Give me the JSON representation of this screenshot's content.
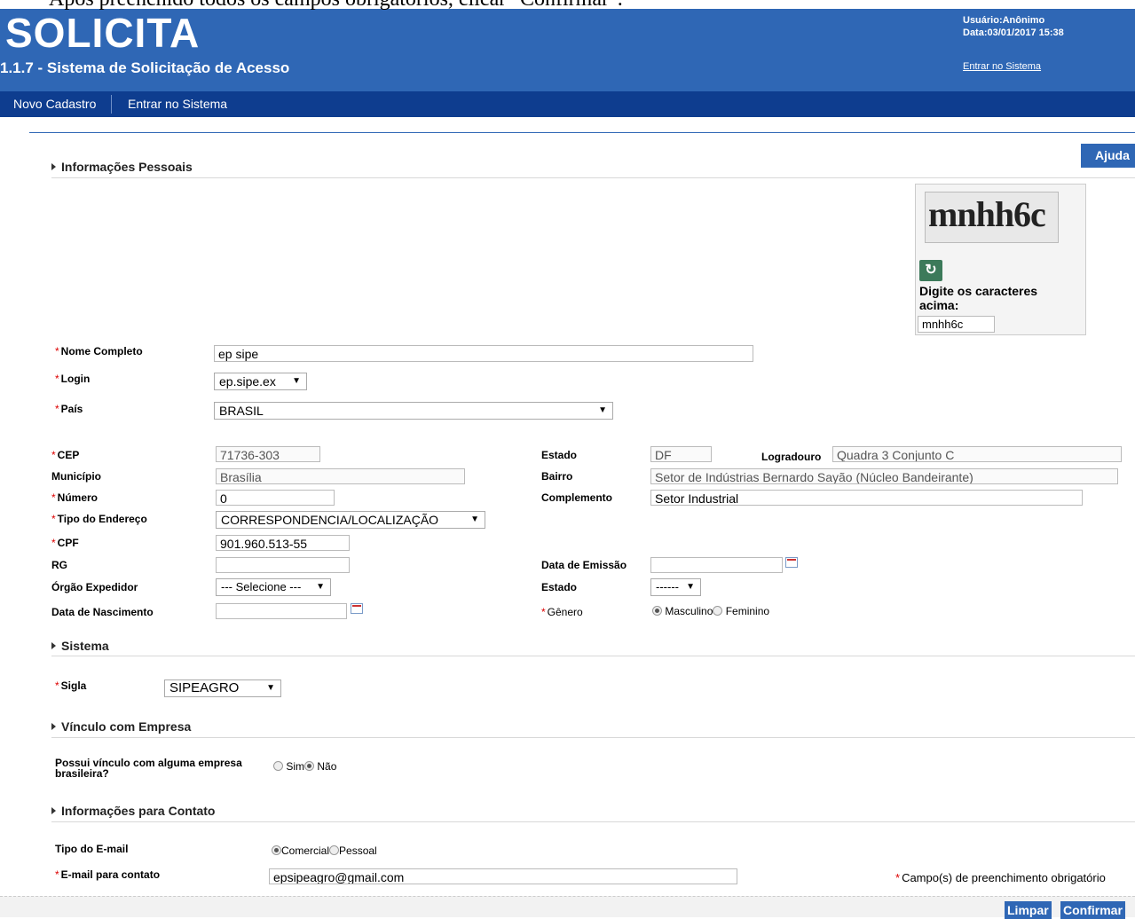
{
  "caption": "Após preenchido todos os campos obrigatórios, clicar \"Confirmar\".",
  "header": {
    "logo": "SOLICITA",
    "system_title": "1.1.7 - Sistema de Solicitação de Acesso",
    "user": "Usuário:Anônimo",
    "date": "Data:03/01/2017 15:38",
    "enter_link": "Entrar no Sistema"
  },
  "menu": {
    "items": [
      "Novo Cadastro",
      "Entrar no Sistema"
    ]
  },
  "help_button": "Ajuda",
  "captcha": {
    "image_text": "mnhh6c",
    "prompt": "Digite os caracteres acima:",
    "value": "mnhh6c"
  },
  "sections": {
    "personal": "Informações Pessoais",
    "system": "Sistema",
    "company": "Vínculo com Empresa",
    "contact": "Informações para Contato"
  },
  "personal": {
    "nome_label": "Nome Completo",
    "nome_value": "ep sipe",
    "login_label": "Login",
    "login_value": "ep.sipe.ex",
    "pais_label": "País",
    "pais_value": "BRASIL",
    "cep_label": "CEP",
    "cep_value": "71736-303",
    "estado_label": "Estado",
    "estado_value": "DF",
    "logradouro_label": "Logradouro",
    "logradouro_value": "Quadra 3 Conjunto C",
    "municipio_label": "Município",
    "municipio_value": "Brasília",
    "bairro_label": "Bairro",
    "bairro_value": "Setor de Indústrias Bernardo Sayão (Núcleo Bandeirante)",
    "numero_label": "Número",
    "numero_value": "0",
    "complemento_label": "Complemento",
    "complemento_value": "Setor Industrial",
    "tipo_endereco_label": "Tipo do Endereço",
    "tipo_endereco_value": "CORRESPONDENCIA/LOCALIZAÇÃO",
    "cpf_label": "CPF",
    "cpf_value": "901.960.513-55",
    "rg_label": "RG",
    "rg_value": "",
    "data_emissao_label": "Data de Emissão",
    "data_emissao_value": "",
    "orgao_label": "Órgão Expedidor",
    "orgao_value": "--- Selecione ---",
    "estado2_label": "Estado",
    "estado2_value": "------",
    "nascimento_label": "Data de Nascimento",
    "nascimento_value": "",
    "genero_label": "Gênero",
    "genero_options": [
      "Masculino",
      "Feminino"
    ],
    "genero_selected": "Masculino"
  },
  "system": {
    "sigla_label": "Sigla",
    "sigla_value": "SIPEAGRO"
  },
  "company": {
    "question": "Possui vínculo com alguma empresa brasileira?",
    "options": [
      "Sim",
      "Não"
    ],
    "selected": "Não"
  },
  "contact": {
    "tipo_label": "Tipo do E-mail",
    "tipo_options": [
      "Comercial",
      "Pessoal"
    ],
    "tipo_selected": "Comercial",
    "email_label": "E-mail para contato",
    "email_value": "epsipeagro@gmail.com",
    "required_note": "Campo(s) de preenchimento obrigatório"
  },
  "required_mark": "*",
  "buttons": {
    "clear": "Limpar",
    "confirm": "Confirmar"
  },
  "colors": {
    "header_blue": "#2f67b5",
    "menu_blue": "#0e3d8f",
    "required_red": "#dd0000"
  }
}
